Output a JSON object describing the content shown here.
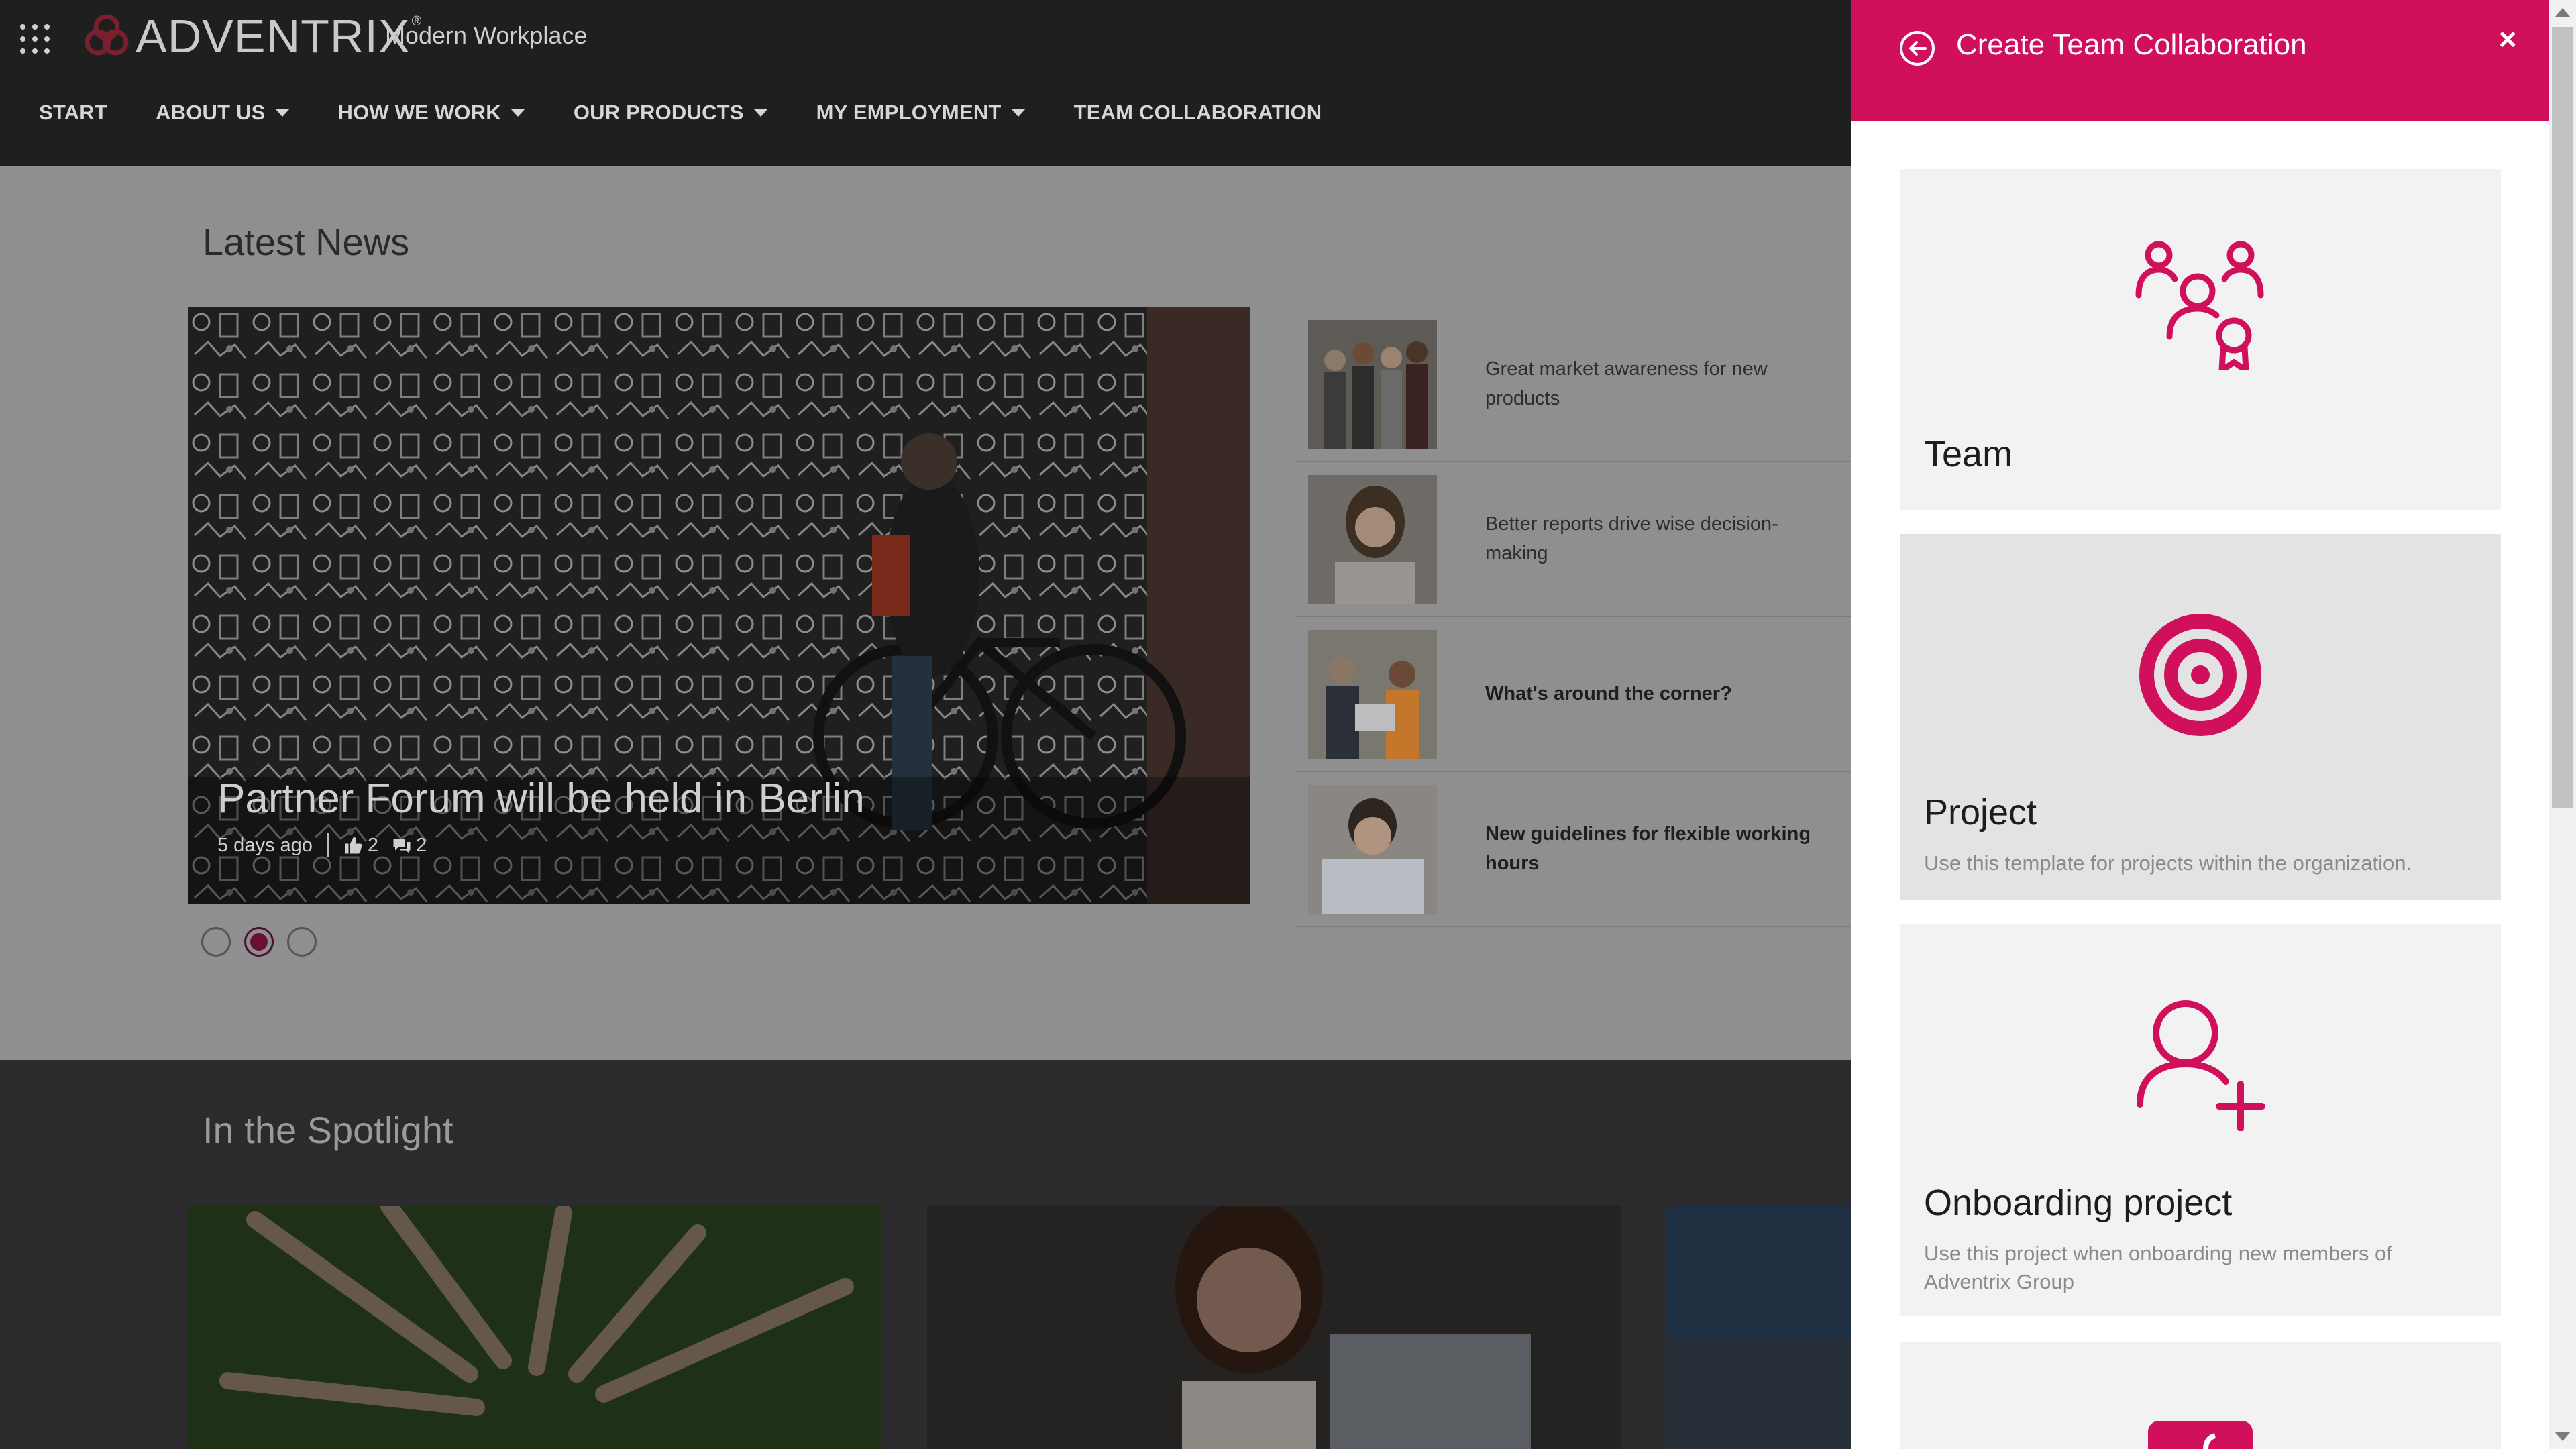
{
  "header": {
    "brand": "ADVENTRIX",
    "brand_reg": "®",
    "site_title": "Modern Workplace",
    "nav": [
      {
        "label": "START",
        "has_menu": false
      },
      {
        "label": "ABOUT US",
        "has_menu": true
      },
      {
        "label": "HOW WE WORK",
        "has_menu": true
      },
      {
        "label": "OUR PRODUCTS",
        "has_menu": true
      },
      {
        "label": "MY EMPLOYMENT",
        "has_menu": true
      },
      {
        "label": "TEAM COLLABORATION",
        "has_menu": false
      }
    ]
  },
  "news": {
    "section_title": "Latest News",
    "hero": {
      "title": "Partner Forum will be held in Berlin",
      "age": "5 days ago",
      "likes": "2",
      "comments": "2"
    },
    "carousel_active_index": 1,
    "items": [
      {
        "text": "Great market awareness for new products",
        "bold": false
      },
      {
        "text": "Better reports drive wise decision-making",
        "bold": false
      },
      {
        "text": "What's around the corner?",
        "bold": true
      },
      {
        "text": "New guidelines for flexible working hours",
        "bold": true
      }
    ]
  },
  "spotlight": {
    "section_title": "In the Spotlight"
  },
  "panel": {
    "title": "Create Team Collaboration",
    "close_symbol": "×",
    "cards": [
      {
        "title": "Team",
        "description": "",
        "icon": "team-icon"
      },
      {
        "title": "Project",
        "description": "Use this template for projects within the organization.",
        "icon": "target-icon"
      },
      {
        "title": "Onboarding project",
        "description": "Use this project when onboarding new members of Adventrix Group",
        "icon": "add-user-icon"
      }
    ]
  },
  "colors": {
    "accent": "#d0105a",
    "header_bg": "#1f1f1f",
    "overlay_page": "#8f8f8f"
  }
}
